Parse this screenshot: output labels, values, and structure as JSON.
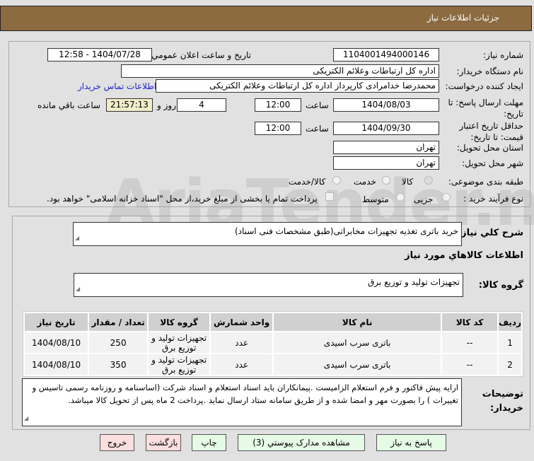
{
  "header": {
    "title": "جزئیات اطلاعات نیاز"
  },
  "watermark": "AriaTender.net",
  "form": {
    "need_number_label": "شماره نیاز:",
    "need_number": "1104001494000146",
    "announce_label": "تاريخ و ساعت اعلان عمومي:",
    "announce_value": "1404/07/28 - 12:58",
    "buyer_org_label": "نام دستگاه خریدار:",
    "buyer_org": "اداره کل ارتباطات وعلائم الکتریکی",
    "creator_label": "ایجاد کننده درخواست:",
    "creator": "محمدرضا خدامرادی کارپرداز اداره کل ارتباطات وعلائم الکتریکی",
    "contact_link": "اطلاعات تماس خریدار",
    "deadline_label": "مهلت ارسال پاسخ: تا تاریخ:",
    "deadline_date": "1404/08/03",
    "time_label": "ساعت",
    "deadline_time": "12:00",
    "days": "4",
    "days_label": "روز و",
    "remaining": "21:57:13",
    "remaining_label": "ساعت باقي مانده",
    "validity_label": "حداقل تاریخ اعتبار قیمت: تا تاریخ:",
    "validity_date": "1404/09/30",
    "validity_time": "12:00",
    "province_label": "استان محل تحویل:",
    "province": "تهران",
    "city_label": "شهر محل تحویل:",
    "city": "تهران",
    "category_label": "طبقه بندی موضوعی:",
    "category_options": [
      "کالا",
      "خدمت",
      "کالا/خدمت"
    ],
    "category_selected": "کالا",
    "process_label": "نوع فرآیند خرید :",
    "process_options": [
      "جزیی",
      "متوسط"
    ],
    "payment_note": "پرداخت تمام یا بخشی از مبلغ خرید،از محل \"اسناد خزانه اسلامی\" خواهد بود."
  },
  "details": {
    "summary_label": "شرح کلي نياز:",
    "summary": "خرید باتری تغذیه تجهیزات مخابراتی(طبق مشخصات فنی اسناد)",
    "goods_heading": "اطلاعات کالاهاي مورد نياز",
    "group_label": "گروه کالا:",
    "group": "تجهیزات تولید و توزیع برق",
    "table": {
      "headers": [
        "ردیف",
        "کد کالا",
        "نام کالا",
        "واحد شمارش",
        "گروه کالا",
        "تعداد / مقدار",
        "تاریخ نیاز"
      ],
      "rows": [
        [
          "1",
          "--",
          "باتری سرب اسیدی",
          "عدد",
          "تجهیزات تولید و توزیع برق",
          "250",
          "1404/08/10"
        ],
        [
          "2",
          "--",
          "باتری سرب اسیدی",
          "عدد",
          "تجهیزات تولید و توزیع برق",
          "350",
          "1404/08/10"
        ]
      ]
    },
    "notes_label": "توضیحات خریدار:",
    "notes": "ارایه پیش فاکتور و فرم استعلام الزامیست .پیمانکاران باید اسناد استعلام و اسناد شرکت (اساسنامه و روزنامه رسمی تاسیس و تغییرات ) را بصورت مهر و امضا شده و از طریق سامانه ستاد ارسال نماید .پرداخت 2 ماه پس از تحویل کالا میباشد."
  },
  "buttons": {
    "reply": "پاسخ به نیاز",
    "attachments": "مشاهده مدارک پیوستي (3)",
    "print": "چاپ",
    "back": "بازگشت",
    "exit": "خروج"
  }
}
